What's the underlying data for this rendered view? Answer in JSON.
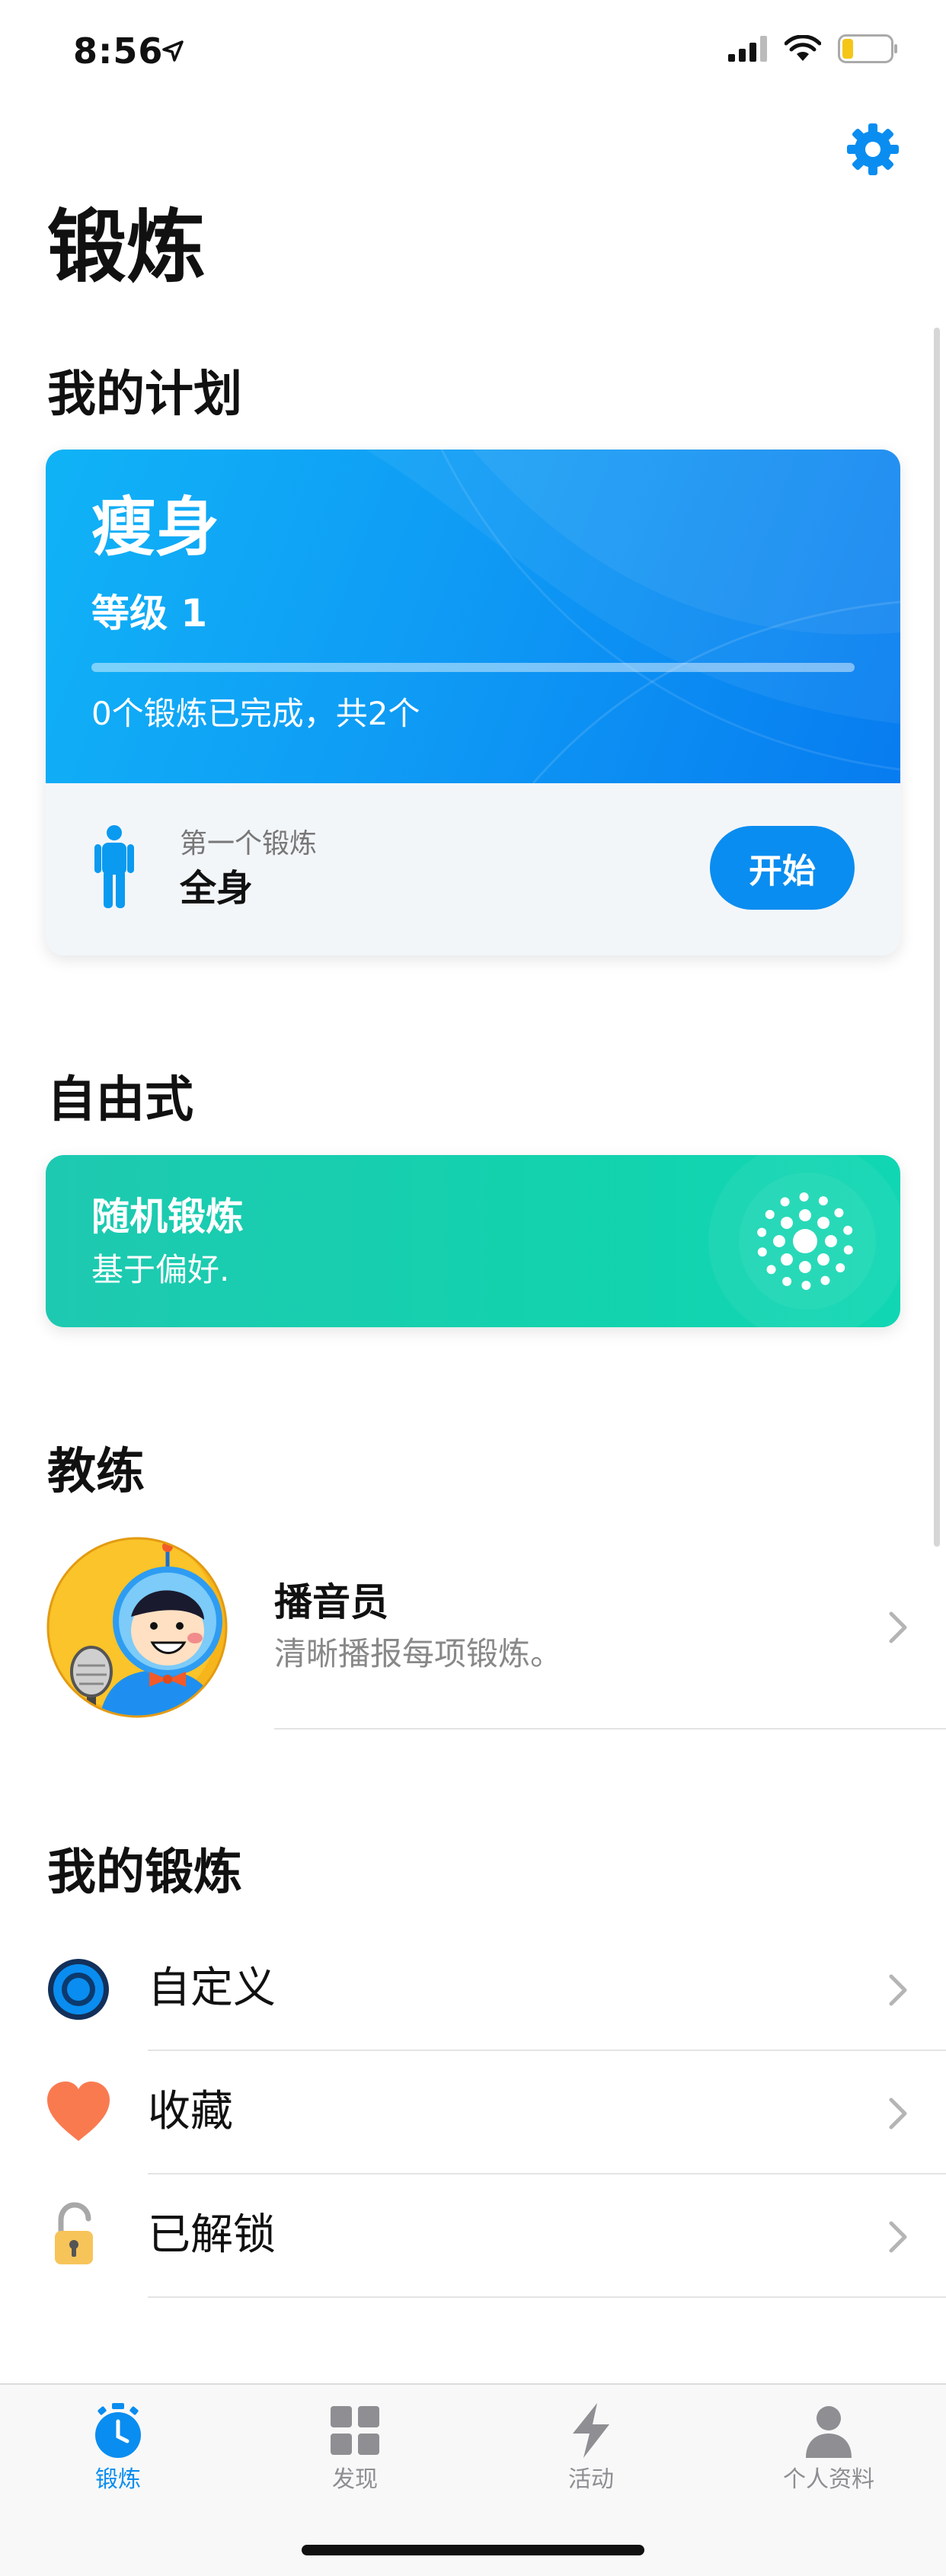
{
  "status_bar": {
    "time": "8:56"
  },
  "header": {
    "title": "锻炼",
    "settings_icon": "gear-icon",
    "accent": "#0a8df0"
  },
  "plan_section": {
    "title": "我的计划",
    "card": {
      "name": "瘦身",
      "level": "等级 1",
      "progress": 0,
      "progress_text": "0个锻炼已完成，共2个",
      "first_label": "第一个锻炼",
      "first_workout": "全身",
      "start_label": "开始"
    }
  },
  "freestyle_section": {
    "title": "自由式",
    "card": {
      "title": "随机锻炼",
      "subtitle": "基于偏好."
    }
  },
  "coach_section": {
    "title": "教练",
    "coach": {
      "name": "播音员",
      "description": "清晰播报每项锻炼。"
    }
  },
  "my_workouts_section": {
    "title": "我的锻炼",
    "items": [
      {
        "label": "自定义",
        "icon": "target-icon"
      },
      {
        "label": "收藏",
        "icon": "heart-icon"
      },
      {
        "label": "已解锁",
        "icon": "unlocked-padlock-icon"
      }
    ]
  },
  "tab_bar": {
    "tabs": [
      {
        "label": "锻炼",
        "icon": "stopwatch-icon",
        "active": true
      },
      {
        "label": "发现",
        "icon": "grid-icon",
        "active": false
      },
      {
        "label": "活动",
        "icon": "lightning-icon",
        "active": false
      },
      {
        "label": "个人资料",
        "icon": "person-icon",
        "active": false
      }
    ],
    "active_color": "#0a8df0",
    "inactive_color": "#8e8e93"
  }
}
